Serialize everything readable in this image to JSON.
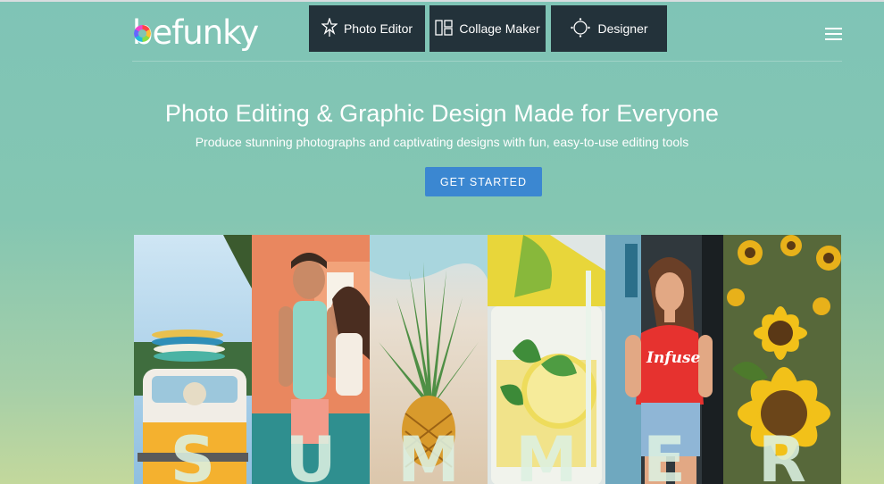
{
  "brand": {
    "name": "befunky"
  },
  "nav": {
    "items": [
      {
        "label": "Photo Editor",
        "icon": "magic-star-icon"
      },
      {
        "label": "Collage Maker",
        "icon": "collage-grid-icon"
      },
      {
        "label": "Designer",
        "icon": "designer-circle-icon"
      }
    ],
    "menu_icon": "hamburger-menu-icon"
  },
  "hero": {
    "title": "Photo Editing & Graphic Design Made for Everyone",
    "subtitle": "Produce stunning photographs and captivating designs with fun, easy-to-use editing tools",
    "cta_label": "GET STARTED"
  },
  "showcase": {
    "panels": [
      {
        "letter": "S",
        "subject": "van-with-surfboards"
      },
      {
        "letter": "U",
        "subject": "couple-portrait"
      },
      {
        "letter": "M",
        "subject": "pineapple-on-beach"
      },
      {
        "letter": "M",
        "subject": "lemon-mint-drink"
      },
      {
        "letter": "E",
        "subject": "woman-infuse-tshirt"
      },
      {
        "letter": "R",
        "subject": "sunflowers"
      }
    ],
    "tshirt_text": "Infuse"
  },
  "colors": {
    "background_top": "#7fc4b6",
    "background_bottom": "#c3d89c",
    "nav_bg": "#23323a",
    "cta_bg": "#3b87d1"
  }
}
